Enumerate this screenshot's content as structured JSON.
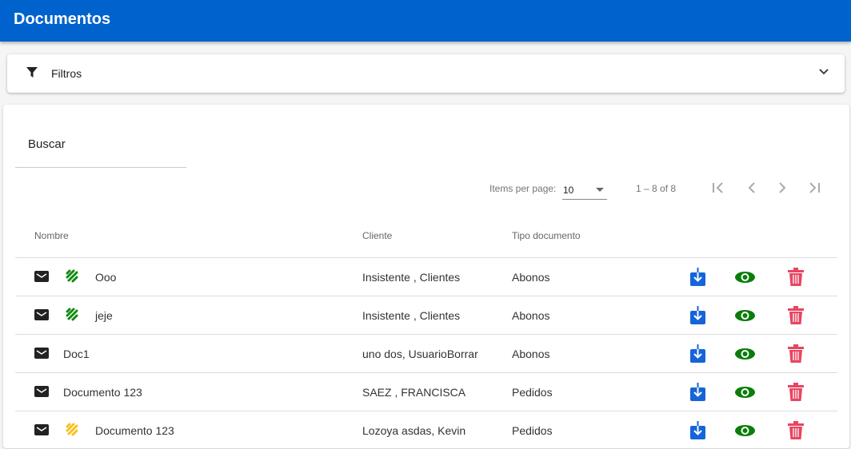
{
  "header": {
    "title": "Documentos"
  },
  "filters": {
    "label": "Filtros"
  },
  "search": {
    "placeholder": "Buscar"
  },
  "paginator": {
    "items_per_page_label": "Items per page:",
    "page_size": "10",
    "range": "1 – 8 of 8"
  },
  "table": {
    "columns": [
      "Nombre",
      "Cliente",
      "Tipo documento"
    ],
    "rows": [
      {
        "nombre": "Ooo",
        "cliente": "Insistente , Clientes",
        "tipo": "Abonos",
        "sign_color": "#138a13"
      },
      {
        "nombre": "jeje",
        "cliente": "Insistente , Clientes",
        "tipo": "Abonos",
        "sign_color": "#138a13"
      },
      {
        "nombre": "Doc1",
        "cliente": "uno dos, UsuarioBorrar",
        "tipo": "Abonos",
        "sign_color": null
      },
      {
        "nombre": "Documento 123",
        "cliente": "SAEZ , FRANCISCA",
        "tipo": "Pedidos",
        "sign_color": null
      },
      {
        "nombre": "Documento 123",
        "cliente": "Lozoya asdas, Kevin",
        "tipo": "Pedidos",
        "sign_color": "#f7c11a"
      }
    ]
  },
  "colors": {
    "primary": "#0062cc",
    "download": "#1565d8",
    "view": "#0a7d0a",
    "delete": "#e94560"
  }
}
